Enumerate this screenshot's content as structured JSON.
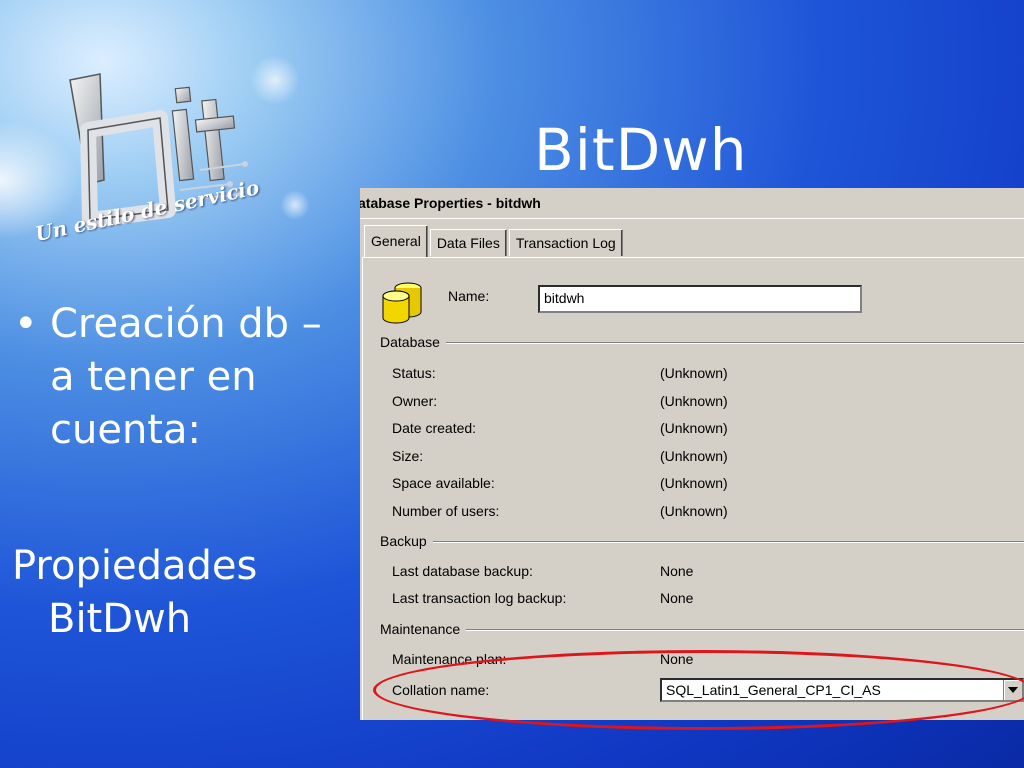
{
  "slide": {
    "title": "BitDwh",
    "bullet_1": "Creación db –\na tener en\ncuenta:",
    "item_2_line1": "Propiedades",
    "item_2_line2": "BitDwh"
  },
  "logo": {
    "tagline": "Un estilo de servicio",
    "mark_text": "bit"
  },
  "dialog": {
    "title": "atabase Properties - bitdwh",
    "tabs": [
      {
        "label": "General",
        "active": true
      },
      {
        "label": "Data Files",
        "active": false
      },
      {
        "label": "Transaction Log",
        "active": false
      }
    ],
    "name_label": "Name:",
    "name_value": "bitdwh",
    "database_group": {
      "label": "Database",
      "rows": [
        {
          "label": "Status:",
          "value": "(Unknown)"
        },
        {
          "label": "Owner:",
          "value": "(Unknown)"
        },
        {
          "label": "Date created:",
          "value": "(Unknown)"
        },
        {
          "label": "Size:",
          "value": "(Unknown)"
        },
        {
          "label": "Space available:",
          "value": "(Unknown)"
        },
        {
          "label": "Number of users:",
          "value": "(Unknown)"
        }
      ]
    },
    "backup_group": {
      "label": "Backup",
      "rows": [
        {
          "label": "Last database backup:",
          "value": "None"
        },
        {
          "label": "Last transaction log backup:",
          "value": "None"
        }
      ]
    },
    "maintenance_group": {
      "label": "Maintenance",
      "rows": [
        {
          "label": "Maintenance plan:",
          "value": "None"
        }
      ],
      "collation_label": "Collation name:",
      "collation_value": "SQL_Latin1_General_CP1_CI_AS"
    }
  },
  "colors": {
    "highlight_ellipse": "#e0141b",
    "dialog_bg": "#d4d0c8"
  }
}
